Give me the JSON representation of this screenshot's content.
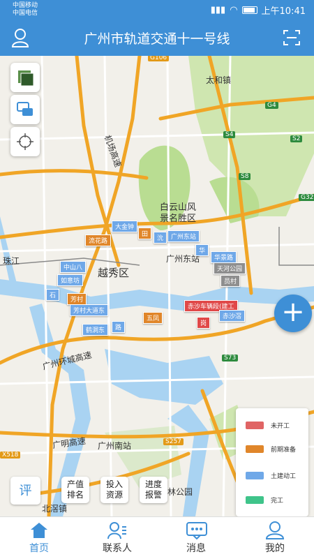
{
  "status_bar": {
    "carrier_1": "中国移动",
    "carrier_2": "中国电信",
    "time": "上午10:41"
  },
  "header": {
    "title": "广州市轨道交通十一号线"
  },
  "map": {
    "place_labels": [
      {
        "id": "taihe",
        "text": "太和镇"
      },
      {
        "id": "baiyun",
        "text": "白云山风"
      },
      {
        "id": "baiyun2",
        "text": "景名胜区"
      },
      {
        "id": "yuexiu",
        "text": "越秀区"
      },
      {
        "id": "zhujiang",
        "text": "珠江"
      },
      {
        "id": "gz_east",
        "text": "广州东站"
      },
      {
        "id": "gz_south",
        "text": "广州南站"
      },
      {
        "id": "ring_hwy",
        "text": "广州环城高速"
      },
      {
        "id": "airport_hwy",
        "text": "机场高速"
      },
      {
        "id": "guangming_hwy",
        "text": "广明高速"
      },
      {
        "id": "forest_park",
        "text": "林公园"
      },
      {
        "id": "beijiao",
        "text": "北滘镇"
      }
    ],
    "road_shields": [
      "G106",
      "G4",
      "S4",
      "S2",
      "S8",
      "G32",
      "S73",
      "S257",
      "X518"
    ],
    "stations": [
      {
        "id": "dajinzhong",
        "text": "大金钟",
        "status": "blue"
      },
      {
        "id": "s_tian",
        "text": "田",
        "status": "orange"
      },
      {
        "id": "s_yan",
        "text": "沇",
        "status": "blue"
      },
      {
        "id": "gz_east_st",
        "text": "广州东站",
        "status": "blue"
      },
      {
        "id": "luhu",
        "text": "流花路",
        "status": "orange"
      },
      {
        "id": "huajing",
        "text": "华景路",
        "status": "blue"
      },
      {
        "id": "s_hua",
        "text": "华",
        "status": "blue"
      },
      {
        "id": "zhongshanba",
        "text": "中山八",
        "status": "blue"
      },
      {
        "id": "tianhe_park",
        "text": "天河公园",
        "status": "gray"
      },
      {
        "id": "ruyifang",
        "text": "如意坊",
        "status": "blue"
      },
      {
        "id": "yuancun",
        "text": "员村",
        "status": "gray"
      },
      {
        "id": "s_shi",
        "text": "石",
        "status": "blue"
      },
      {
        "id": "fangcun",
        "text": "芳村",
        "status": "orange"
      },
      {
        "id": "chisha",
        "text": "赤沙车辆段(建工",
        "status": "red"
      },
      {
        "id": "fangcun_ave",
        "text": "芳村大道东",
        "status": "blue"
      },
      {
        "id": "s_wu",
        "text": "五凤",
        "status": "orange"
      },
      {
        "id": "chisha_bin",
        "text": "赤沙滘",
        "status": "blue"
      },
      {
        "id": "hedong",
        "text": "鹤洞东",
        "status": "blue"
      },
      {
        "id": "s_lu",
        "text": "路",
        "status": "blue"
      },
      {
        "id": "s_gang",
        "text": "岗",
        "status": "red"
      }
    ]
  },
  "legend": [
    {
      "label": "未开工",
      "color": "#e06464"
    },
    {
      "label": "前期准备",
      "color": "#e0862a"
    },
    {
      "label": "土建动工",
      "color": "#6fa8e8"
    },
    {
      "label": "完工",
      "color": "#3fc48a"
    }
  ],
  "actions": {
    "rate": "评",
    "output_rank": [
      "产值",
      "排名"
    ],
    "input_resource": [
      "投入",
      "资源"
    ],
    "progress_alarm": [
      "进度",
      "报警"
    ]
  },
  "tabs": [
    {
      "id": "home",
      "label": "首页"
    },
    {
      "id": "contacts",
      "label": "联系人"
    },
    {
      "id": "messages",
      "label": "消息"
    },
    {
      "id": "mine",
      "label": "我的"
    }
  ],
  "colors": {
    "primary": "#3e8fd6",
    "map_bg": "#f2f0ea",
    "water": "#a9d3f2",
    "park": "#b9dd92",
    "highway": "#f0a526"
  }
}
